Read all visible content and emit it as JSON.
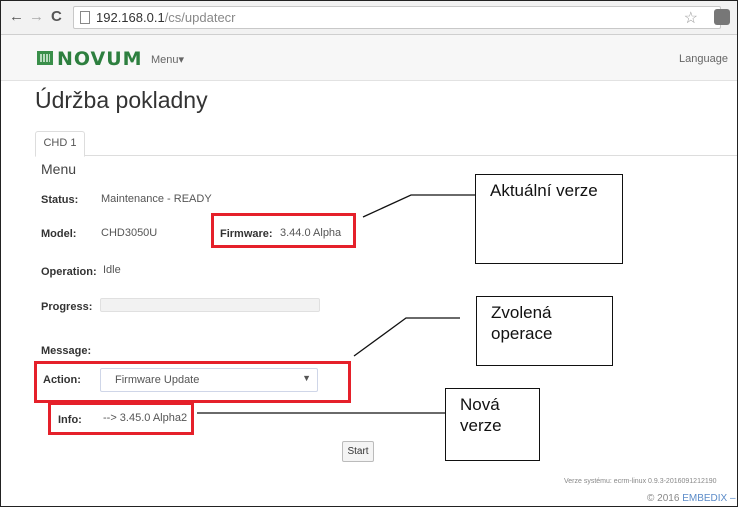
{
  "browser": {
    "url_host": "192.168.0.1",
    "url_path": "/cs/updatecr",
    "nav_icons": [
      "back-arrow-icon",
      "forward-arrow-icon",
      "reload-icon",
      "page-icon",
      "star-icon",
      "extension-icon"
    ]
  },
  "navbar": {
    "brand": "NOVUM",
    "menu_label": "Menu▾",
    "language_label": "Language"
  },
  "page": {
    "title": "Údržba pokladny",
    "tab": "CHD 1",
    "section": "Menu"
  },
  "fields": {
    "status_label": "Status:",
    "status_value": "Maintenance - READY",
    "model_label": "Model:",
    "model_value": "CHD3050U",
    "firmware_label": "Firmware:",
    "firmware_value": "3.44.0 Alpha",
    "operation_label": "Operation:",
    "operation_value": "Idle",
    "progress_label": "Progress:",
    "message_label": "Message:",
    "action_label": "Action:",
    "action_selected": "Firmware Update",
    "info_label": "Info:",
    "info_value": "--> 3.45.0 Alpha2"
  },
  "buttons": {
    "start": "Start"
  },
  "footer": {
    "system_version": "Verze systému: ecrm-linux 0.9.3-2016091212190",
    "copyright_prefix": "© 2016",
    "copyright_brand": "EMBEDIX –"
  },
  "annotations": {
    "current_version": "Aktuální verze",
    "selected_operation": "Zvolená operace",
    "new_version": "Nová verze"
  },
  "colors": {
    "annotation_red": "#e5202a",
    "brand_green": "#2d7f3f",
    "link_blue": "#5b8bc8"
  }
}
